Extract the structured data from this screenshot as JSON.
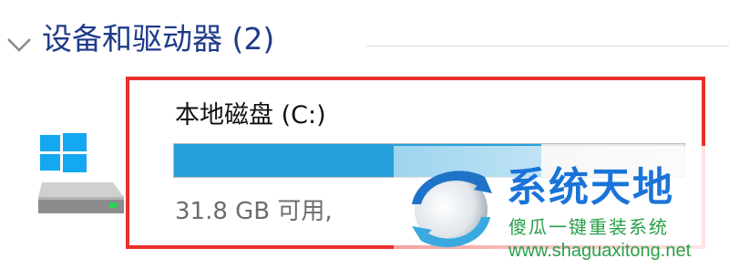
{
  "section": {
    "title": "设备和驱动器 (2)",
    "chevron_icon": "chevron-down-icon"
  },
  "drive": {
    "icon": "windows-drive-icon",
    "name": "本地磁盘 (C:)",
    "usage_fraction": 0.72,
    "free_text": "31.8 GB 可用,"
  },
  "highlight_color": "#e8302c",
  "bar_color": "#26a0da",
  "watermark": {
    "title": "系统天地",
    "subtitle": "傻瓜一键重装系统",
    "url": "www.shaguaxitong.net"
  }
}
